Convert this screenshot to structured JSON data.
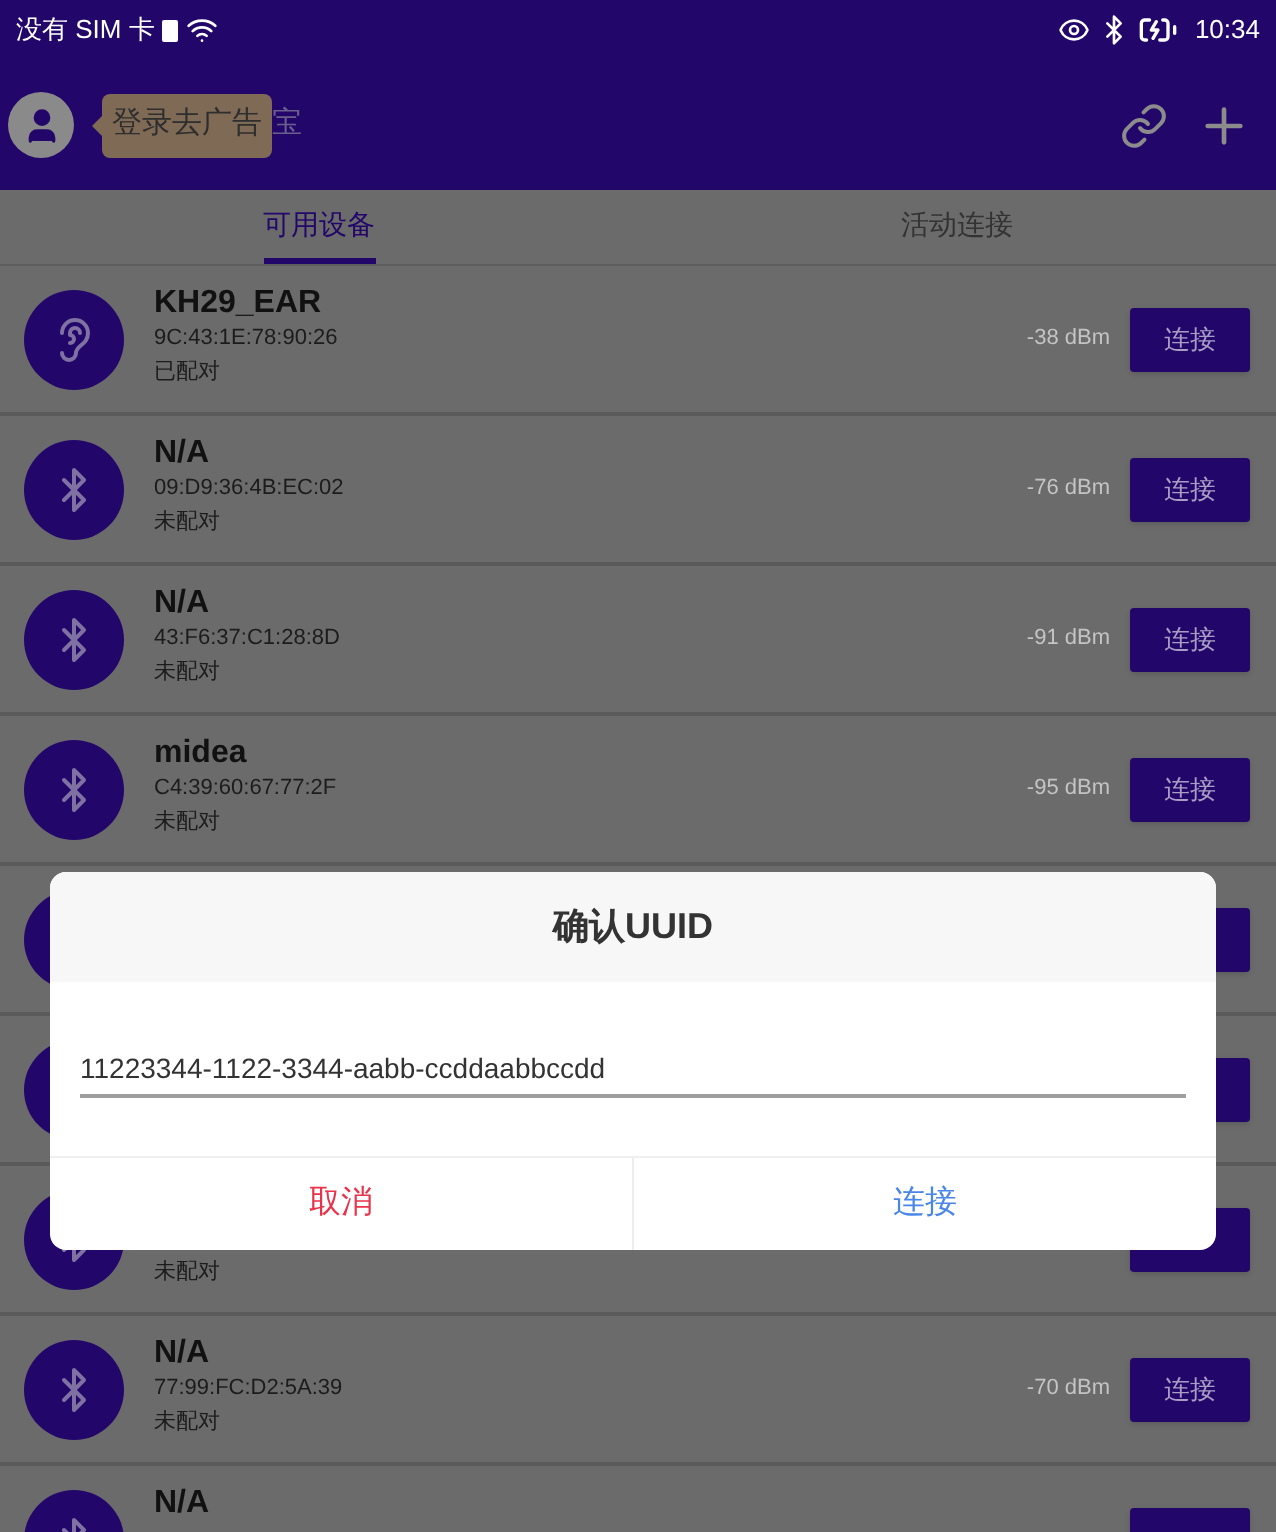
{
  "status_bar": {
    "carrier": "没有 SIM 卡",
    "time": "10:34"
  },
  "header": {
    "tooltip": "登录去广告",
    "title_fragment": "宝"
  },
  "tabs": [
    {
      "label": "可用设备",
      "selected": true
    },
    {
      "label": "活动连接",
      "selected": false
    }
  ],
  "devices": [
    {
      "kind": "headset",
      "name": "KH29_EAR",
      "address": "9C:43:1E:78:90:26",
      "status": "已配对",
      "rssi": "-38 dBm",
      "button": "连接"
    },
    {
      "kind": "bluetooth",
      "name": "N/A",
      "address": "09:D9:36:4B:EC:02",
      "status": "未配对",
      "rssi": "-76 dBm",
      "button": "连接"
    },
    {
      "kind": "bluetooth",
      "name": "N/A",
      "address": "43:F6:37:C1:28:8D",
      "status": "未配对",
      "rssi": "-91 dBm",
      "button": "连接"
    },
    {
      "kind": "bluetooth",
      "name": "midea",
      "address": "C4:39:60:67:77:2F",
      "status": "未配对",
      "rssi": "-95 dBm",
      "button": "连接"
    },
    {
      "kind": "covered"
    },
    {
      "kind": "covered"
    },
    {
      "kind": "bluetooth",
      "status": "未配对"
    },
    {
      "kind": "bluetooth",
      "name": "N/A",
      "address": "77:99:FC:D2:5A:39",
      "status": "未配对",
      "rssi": "-70 dBm",
      "button": "连接"
    },
    {
      "kind": "bluetooth",
      "name": "N/A"
    }
  ],
  "dialog": {
    "title": "确认UUID",
    "value": "11223344-1122-3344-aabb-ccddaabbccdd",
    "buttons": [
      {
        "label": "取消",
        "kind": "cancel"
      },
      {
        "label": "连接",
        "kind": "confirm"
      }
    ]
  }
}
